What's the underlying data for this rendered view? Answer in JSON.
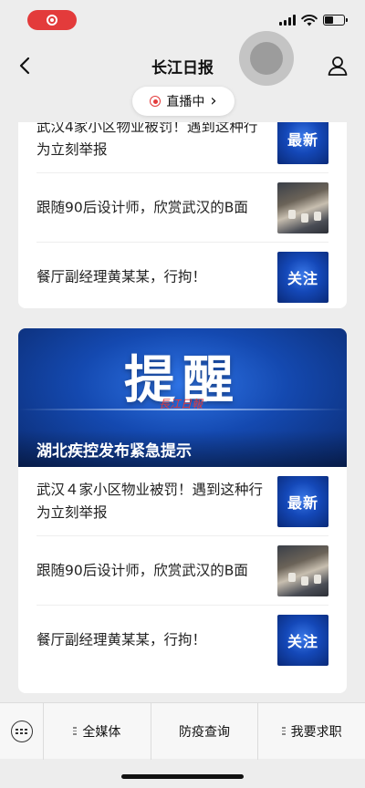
{
  "nav": {
    "title": "长江日报",
    "live_label": "直播中",
    "live_chevron": "›"
  },
  "colors": {
    "accent_red": "#e33b3b",
    "thumb_blue": "#1448b8",
    "banner_blue": "#1449b0"
  },
  "status": {
    "battery_level": 0.45
  },
  "card1": {
    "items": [
      {
        "title": "武汉4家小区物业被罚！遇到这种行为立刻举报",
        "thumb": "最新",
        "thumb_type": "blue"
      },
      {
        "title": "跟随90后设计师，欣赏武汉的B面",
        "thumb": "",
        "thumb_type": "photo"
      },
      {
        "title": "餐厅副经理黄某某，行拘！",
        "thumb": "关注",
        "thumb_type": "blue"
      }
    ]
  },
  "card2": {
    "banner_text": "提醒",
    "banner_caption": "湖北疾控发布紧急提示",
    "items": [
      {
        "title": "武汉４家小区物业被罚！遇到这种行为立刻举报",
        "thumb": "最新",
        "thumb_type": "blue"
      },
      {
        "title": "跟随90后设计师，欣赏武汉的B面",
        "thumb": "",
        "thumb_type": "photo"
      },
      {
        "title": "餐厅副经理黄某某，行拘！",
        "thumb": "关注",
        "thumb_type": "blue"
      }
    ]
  },
  "menu": {
    "items": [
      {
        "label": "全媒体",
        "has_submenu": true
      },
      {
        "label": "防疫查询",
        "has_submenu": false
      },
      {
        "label": "我要求职",
        "has_submenu": true
      }
    ]
  }
}
